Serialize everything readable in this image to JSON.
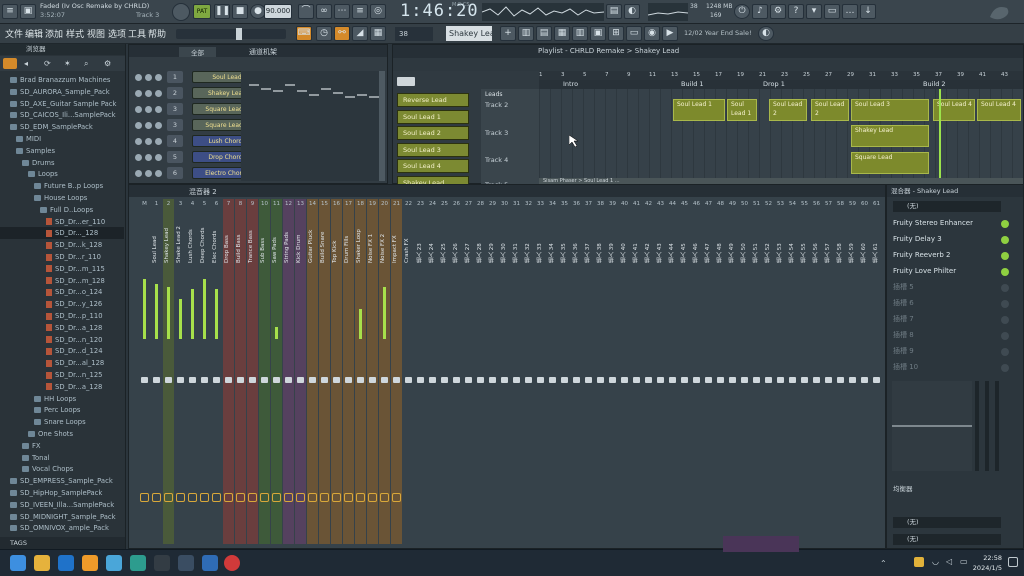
{
  "window": {
    "song_title": "Faded (Iv Osc Remake by CHRLD)",
    "song_time": "3:52:07",
    "track_indicator": "Track 3",
    "tempo": "90.000",
    "time_display": "1:46:20",
    "time_sub": "M:S:CS",
    "cpu_value": "38",
    "ram_value": "1248 MB",
    "voices": "169"
  },
  "menu": [
    "文件",
    "编辑",
    "添加",
    "样式",
    "视图",
    "选项",
    "工具",
    "帮助"
  ],
  "toolbar": {
    "pattern_number": "38",
    "instrument_selector": "Shakey Lead",
    "hint_text": "12/02 Year End Sale!"
  },
  "browser": {
    "header": "浏览器",
    "items": [
      {
        "label": "Brad Branazzum Machines",
        "indent": 1,
        "kind": "folder"
      },
      {
        "label": "SD_AURORA_Sample_Pack",
        "indent": 1,
        "kind": "folder"
      },
      {
        "label": "SD_AXE_Guitar Sample Pack",
        "indent": 1,
        "kind": "folder"
      },
      {
        "label": "SD_CAICOS_Ili...SamplePack",
        "indent": 1,
        "kind": "folder"
      },
      {
        "label": "SD_EDM_SamplePack",
        "indent": 1,
        "kind": "folder"
      },
      {
        "label": "MIDI",
        "indent": 2,
        "kind": "folder"
      },
      {
        "label": "Samples",
        "indent": 2,
        "kind": "folder"
      },
      {
        "label": "Drums",
        "indent": 3,
        "kind": "folder"
      },
      {
        "label": "Loops",
        "indent": 4,
        "kind": "folder"
      },
      {
        "label": "Future B..p Loops",
        "indent": 5,
        "kind": "folder"
      },
      {
        "label": "House Loops",
        "indent": 5,
        "kind": "folder"
      },
      {
        "label": "Full D..Loops",
        "indent": 6,
        "kind": "folder"
      },
      {
        "label": "SD_Dr...er_110",
        "indent": 7,
        "kind": "audio"
      },
      {
        "label": "SD_Dr..._128",
        "indent": 7,
        "kind": "audio"
      },
      {
        "label": "SD_Dr...k_128",
        "indent": 7,
        "kind": "audio"
      },
      {
        "label": "SD_Dr...r_110",
        "indent": 7,
        "kind": "audio"
      },
      {
        "label": "SD_Dr...m_115",
        "indent": 7,
        "kind": "audio"
      },
      {
        "label": "SD_Dr...m_128",
        "indent": 7,
        "kind": "audio"
      },
      {
        "label": "SD_Dr...o_124",
        "indent": 7,
        "kind": "audio"
      },
      {
        "label": "SD_Dr...y_126",
        "indent": 7,
        "kind": "audio"
      },
      {
        "label": "SD_Dr...p_110",
        "indent": 7,
        "kind": "audio"
      },
      {
        "label": "SD_Dr...a_128",
        "indent": 7,
        "kind": "audio"
      },
      {
        "label": "SD_Dr...n_120",
        "indent": 7,
        "kind": "audio"
      },
      {
        "label": "SD_Dr...d_124",
        "indent": 7,
        "kind": "audio"
      },
      {
        "label": "SD_Dr...al_128",
        "indent": 7,
        "kind": "audio"
      },
      {
        "label": "SD_Dr...n_125",
        "indent": 7,
        "kind": "audio"
      },
      {
        "label": "SD_Dr...a_128",
        "indent": 7,
        "kind": "audio"
      },
      {
        "label": "HH Loops",
        "indent": 5,
        "kind": "folder"
      },
      {
        "label": "Perc Loops",
        "indent": 5,
        "kind": "folder"
      },
      {
        "label": "Snare Loops",
        "indent": 5,
        "kind": "folder"
      },
      {
        "label": "One Shots",
        "indent": 4,
        "kind": "folder"
      },
      {
        "label": "FX",
        "indent": 3,
        "kind": "folder"
      },
      {
        "label": "Tonal",
        "indent": 3,
        "kind": "folder"
      },
      {
        "label": "Vocal Chops",
        "indent": 3,
        "kind": "folder"
      },
      {
        "label": "SD_EMPRESS_Sample_Pack",
        "indent": 1,
        "kind": "folder"
      },
      {
        "label": "SD_HipHop_SamplePack",
        "indent": 1,
        "kind": "folder"
      },
      {
        "label": "SD_IVEEN_Illa...SamplePack",
        "indent": 1,
        "kind": "folder"
      },
      {
        "label": "SD_MIDNIGHT_Sample_Pack",
        "indent": 1,
        "kind": "folder"
      },
      {
        "label": "SD_OMNIVOX_ample_Pack",
        "indent": 1,
        "kind": "folder"
      }
    ],
    "footer": "TAGS"
  },
  "channel_rack": {
    "filter": "全部",
    "title": "通道机架",
    "channels": [
      {
        "num": "1",
        "name": "Soul Lead"
      },
      {
        "num": "2",
        "name": "Shakey Lead"
      },
      {
        "num": "3",
        "name": "Square Lead 1"
      },
      {
        "num": "3",
        "name": "Square Lead 2"
      },
      {
        "num": "4",
        "name": "Lush Chords"
      },
      {
        "num": "5",
        "name": "Drop Chords"
      },
      {
        "num": "6",
        "name": "Electro Chords"
      }
    ]
  },
  "playlist": {
    "title": "Playlist - CHRLD Remake > Shakey Lead",
    "patterns": [
      "Reverse Lead",
      "Soul Lead 1",
      "Soul Lead 2",
      "Soul Lead 3",
      "Soul Lead 4",
      "Shakey Lead"
    ],
    "tracks": [
      "Track 2",
      "Track 3",
      "Track 4",
      "Track 5"
    ],
    "markers": [
      "Intro",
      "Build 1",
      "Drop 1",
      "Build 2"
    ],
    "bar_numbers": [
      "1",
      "3",
      "5",
      "7",
      "9",
      "11",
      "13",
      "15",
      "17",
      "19",
      "21",
      "23",
      "25",
      "27",
      "29",
      "31",
      "33",
      "35",
      "37",
      "39",
      "41",
      "43"
    ],
    "clips": [
      {
        "label": "Soul Lead 1",
        "lane": 0
      },
      {
        "label": "Soul Lead 1",
        "lane": 0
      },
      {
        "label": "Soul Lead 2",
        "lane": 0
      },
      {
        "label": "Soul Lead 2",
        "lane": 0
      },
      {
        "label": "Soul Lead 3",
        "lane": 0
      },
      {
        "label": "Soul Lead 4",
        "lane": 0
      },
      {
        "label": "Soul Lead 4",
        "lane": 0
      },
      {
        "label": "Shakey Lead",
        "lane": 1
      },
      {
        "label": "Square Lead",
        "lane": 2
      }
    ],
    "leads_label": "Leads",
    "bottom_clip": "Sisam Phaser > Soul Lead 1 ..."
  },
  "mixer": {
    "title": "混音器 2",
    "strips": [
      "M",
      "1",
      "2",
      "3",
      "4",
      "5",
      "6",
      "7",
      "8",
      "9",
      "10",
      "11",
      "12",
      "13",
      "14",
      "15",
      "16",
      "17",
      "18",
      "19",
      "20",
      "21",
      "22",
      "23",
      "24",
      "25",
      "26",
      "27",
      "28",
      "29",
      "30",
      "31",
      "32",
      "33",
      "34",
      "35",
      "36",
      "37",
      "38",
      "39",
      "40",
      "41",
      "42",
      "43",
      "44",
      "45",
      "46",
      "47",
      "48",
      "49",
      "50",
      "51",
      "52",
      "53",
      "54",
      "55",
      "56",
      "57",
      "58",
      "59",
      "60",
      "61"
    ],
    "names": [
      "Soul Lead",
      "Shakey Lead",
      "Shake Lead 2",
      "Lush Chords",
      "Deep Chords",
      "Elec Chords",
      "Drop Bass",
      "Build Bass",
      "Trance Bass",
      "Sub Bass",
      "Saw Pads",
      "String Pads",
      "Kick Drum",
      "Guitar Pluck",
      "Build Snare",
      "Top Kick",
      "Drum Fills",
      "Shaker Loop",
      "Noise FX 1",
      "Noise FX 2",
      "Impact FX",
      "Crash FX",
      "插入 23",
      "插入 24",
      "插入 25",
      "插入 26",
      "插入 27",
      "插入 28",
      "插入 29",
      "插入 30",
      "插入 31",
      "插入 32",
      "插入 33",
      "插入 34",
      "插入 35",
      "插入 36",
      "插入 37",
      "插入 38",
      "插入 39",
      "插入 40",
      "插入 41",
      "插入 42",
      "插入 43",
      "插入 44",
      "插入 45",
      "插入 46",
      "插入 47",
      "插入 48",
      "插入 49",
      "插入 50",
      "插入 51",
      "插入 52",
      "插入 53",
      "插入 54",
      "插入 55",
      "插入 56",
      "插入 57",
      "插入 58",
      "插入 59",
      "插入 60",
      "插入 61"
    ]
  },
  "inserts": {
    "title": "混合器 - Shakey Lead",
    "input": "(无)",
    "effects": [
      "Fruity Stereo Enhancer",
      "Fruity Delay 3",
      "Fruity Reeverb 2",
      "Fruity Love Philter",
      "插槽 5",
      "插槽 6",
      "插槽 7",
      "插槽 8",
      "插槽 9",
      "插槽 10"
    ],
    "eq_label": "均衡器",
    "output": "(无)",
    "output2": "(无)"
  },
  "taskbar": {
    "clock_time": "22:58",
    "clock_date": "2024/1/5"
  },
  "colors": {
    "accent_green": "#a8e15a",
    "clip_olive": "#7d8a2c",
    "playhead": "#9be34b"
  }
}
